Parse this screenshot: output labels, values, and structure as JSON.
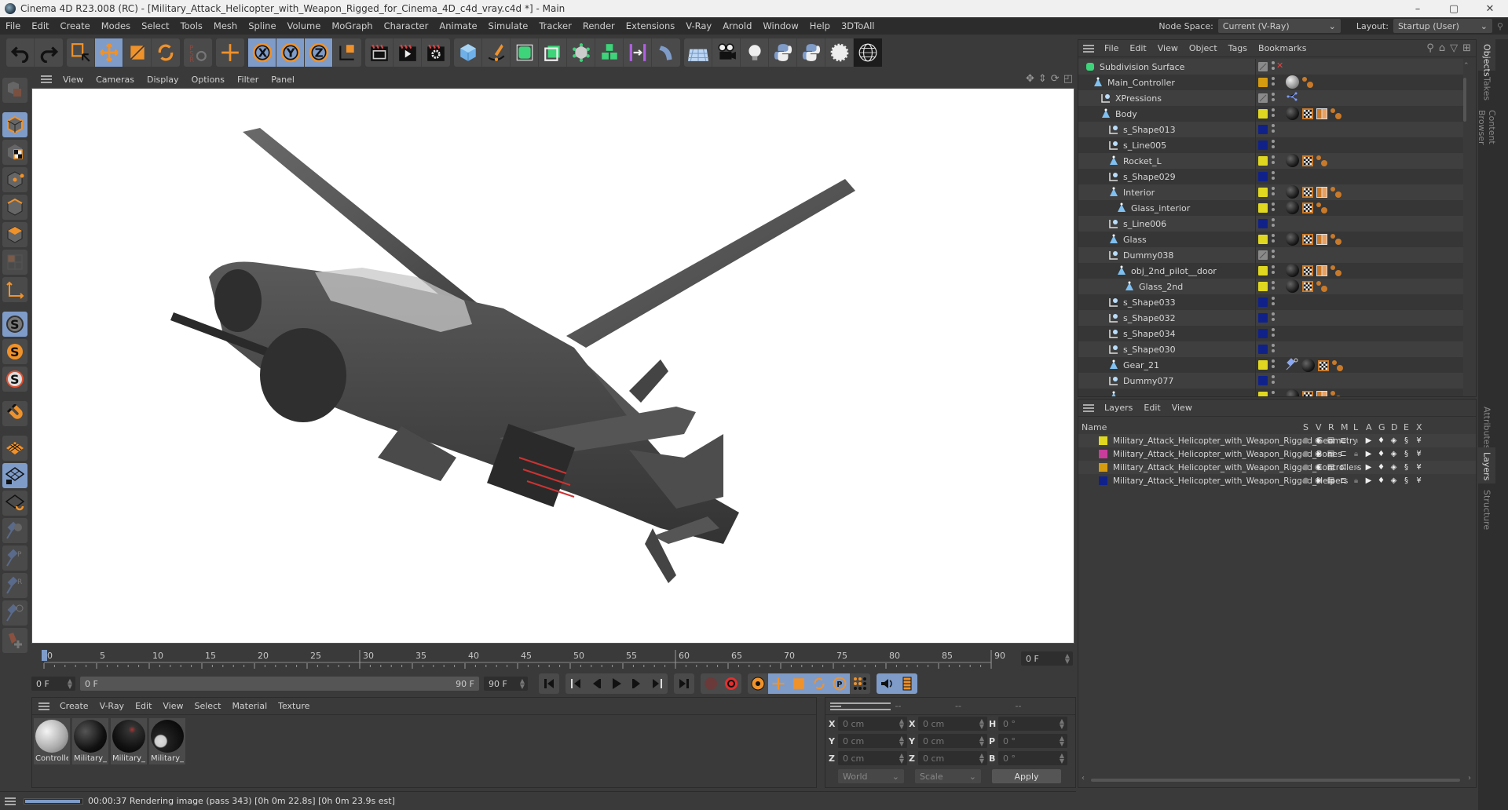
{
  "window": {
    "title": "Cinema 4D R23.008 (RC) - [Military_Attack_Helicopter_with_Weapon_Rigged_for_Cinema_4D_c4d_vray.c4d *] - Main",
    "controls": {
      "minimize": "–",
      "maximize": "▢",
      "close": "✕"
    }
  },
  "menubar": {
    "items": [
      "File",
      "Edit",
      "Create",
      "Modes",
      "Select",
      "Tools",
      "Mesh",
      "Spline",
      "Volume",
      "MoGraph",
      "Character",
      "Animate",
      "Simulate",
      "Tracker",
      "Render",
      "Extensions",
      "V-Ray",
      "Arnold",
      "Window",
      "Help",
      "3DToAll"
    ],
    "node_space_label": "Node Space:",
    "node_space_value": "Current (V-Ray)",
    "layout_label": "Layout:",
    "layout_value": "Startup (User)"
  },
  "toolbar": {
    "groups": [
      [
        "undo-icon",
        "redo-icon"
      ],
      [
        "live-selection-icon",
        "move-icon",
        "scale-icon",
        "rotate-icon"
      ],
      [
        "psr-icon"
      ],
      [
        "axis-move-icon"
      ],
      [
        "x-axis-lock-icon",
        "y-axis-lock-icon",
        "z-axis-lock-icon",
        "coordinate-system-icon"
      ],
      [
        "render-view-icon",
        "render-to-picture-viewer-icon",
        "render-settings-icon"
      ],
      [
        "cube-primitive-icon",
        "pen-spline-icon",
        "subdivision-surface-icon",
        "extrude-icon",
        "cloner-icon",
        "mograph-cubes-icon",
        "symmetry-icon",
        "deformer-icon"
      ],
      [
        "floor-icon",
        "camera-icon",
        "light-icon",
        "python-icon",
        "python-generator-icon",
        "sky-icon",
        "vray-dome-icon"
      ]
    ],
    "active": [
      "move-icon",
      "x-axis-lock-icon",
      "y-axis-lock-icon",
      "z-axis-lock-icon"
    ]
  },
  "lefttools": {
    "items": [
      "make-editable-icon",
      "model-mode-icon",
      "texture-mode-icon",
      "points-mode-icon",
      "edges-mode-icon",
      "polygons-mode-icon",
      "uv-mode-icon",
      "axis-mode-icon",
      "solo-icon",
      "solo-single-icon",
      "solo-hierarchy-icon",
      "snap-icon",
      "workplane-icon",
      "locked-workplane-icon",
      "workplane-rotate-icon",
      "pin-icon",
      "pin-p-icon",
      "pin-r-icon",
      "pin-target-icon",
      "joint-tool-icon"
    ]
  },
  "viewport": {
    "menu": [
      "View",
      "Cameras",
      "Display",
      "Options",
      "Filter",
      "Panel"
    ],
    "nav_icons": [
      "move-view-icon",
      "zoom-view-icon",
      "rotate-view-icon",
      "maximize-view-icon"
    ],
    "content": "Military attack helicopter render, gray, viewed from below"
  },
  "timeline": {
    "ticks": [
      0,
      5,
      10,
      15,
      20,
      25,
      30,
      35,
      40,
      45,
      50,
      55,
      60,
      65,
      70,
      75,
      80,
      85,
      90
    ],
    "range_max": 90,
    "current_frame": 0,
    "current_frame_field": "0 F"
  },
  "transport": {
    "start_field": "0 F",
    "range_start": "0 F",
    "range_end": "90 F",
    "end_field": "90 F",
    "buttons": [
      "go-to-start-icon",
      "prev-key-icon",
      "prev-frame-icon",
      "play-icon",
      "next-frame-icon",
      "next-key-icon",
      "go-to-end-icon",
      "record-disabled-icon",
      "autokey-icon",
      "keyframe-settings-icon",
      "key-position-icon",
      "key-scale-icon",
      "key-rotation-icon",
      "key-parameter-icon",
      "key-pla-icon",
      "sound-icon",
      "film-icon"
    ]
  },
  "material_manager": {
    "menu": [
      "Create",
      "V-Ray",
      "Edit",
      "View",
      "Select",
      "Material",
      "Texture"
    ],
    "materials": [
      {
        "label": "Controlle",
        "color": "white"
      },
      {
        "label": "Military_",
        "color": "black"
      },
      {
        "label": "Military_",
        "color": "black-red"
      },
      {
        "label": "Military_",
        "color": "black-white"
      }
    ]
  },
  "coordinates": {
    "headers": [
      "--",
      "--",
      "--"
    ],
    "rows": [
      {
        "a": "X",
        "pos": "0 cm",
        "b": "X",
        "size": "0 cm",
        "c": "H",
        "rot": "0 °"
      },
      {
        "a": "Y",
        "pos": "0 cm",
        "b": "Y",
        "size": "0 cm",
        "c": "P",
        "rot": "0 °"
      },
      {
        "a": "Z",
        "pos": "0 cm",
        "b": "Z",
        "size": "0 cm",
        "c": "B",
        "rot": "0 °"
      }
    ],
    "mode": "World",
    "scale_mode": "Scale",
    "apply": "Apply"
  },
  "status": {
    "progress": 0.95,
    "text": "00:00:37 Rendering image (pass 343) [0h  0m 22.8s] [0h  0m 23.9s est]"
  },
  "object_manager": {
    "menu": [
      "File",
      "Edit",
      "View",
      "Object",
      "Tags",
      "Bookmarks"
    ],
    "objects": [
      {
        "name": "Subdivision Surface",
        "indent": 0,
        "type": "subdiv",
        "color": "#7a7a7a",
        "tags": [],
        "disabled": true
      },
      {
        "name": "Main_Controller",
        "indent": 1,
        "type": "joint",
        "color": "#d49a10",
        "tags": [
          "mat-white",
          "ball"
        ]
      },
      {
        "name": "XPressions",
        "indent": 2,
        "type": "null",
        "color": "#7a7a7a",
        "tags": [
          "xpresso"
        ]
      },
      {
        "name": "Body",
        "indent": 2,
        "type": "joint",
        "color": "#e0d820",
        "tags": [
          "mat",
          "chk",
          "uv",
          "ball"
        ]
      },
      {
        "name": "s_Shape013",
        "indent": 3,
        "type": "null",
        "color": "#10228a",
        "tags": []
      },
      {
        "name": "s_Line005",
        "indent": 3,
        "type": "null",
        "color": "#10228a",
        "tags": []
      },
      {
        "name": "Rocket_L",
        "indent": 3,
        "type": "joint",
        "color": "#e0d820",
        "tags": [
          "mat",
          "chk",
          "ball"
        ]
      },
      {
        "name": "s_Shape029",
        "indent": 3,
        "type": "null",
        "color": "#10228a",
        "tags": []
      },
      {
        "name": "Interior",
        "indent": 3,
        "type": "joint",
        "color": "#e0d820",
        "tags": [
          "mat",
          "chk",
          "uv",
          "ball"
        ]
      },
      {
        "name": "Glass_interior",
        "indent": 4,
        "type": "joint",
        "color": "#e0d820",
        "tags": [
          "mat",
          "chk",
          "ball"
        ]
      },
      {
        "name": "s_Line006",
        "indent": 3,
        "type": "null",
        "color": "#10228a",
        "tags": []
      },
      {
        "name": "Glass",
        "indent": 3,
        "type": "joint",
        "color": "#e0d820",
        "tags": [
          "mat",
          "chk",
          "uv",
          "ball"
        ]
      },
      {
        "name": "Dummy038",
        "indent": 3,
        "type": "null",
        "color": "#7a7a7a",
        "tags": []
      },
      {
        "name": "obj_2nd_pilot__door",
        "indent": 4,
        "type": "joint",
        "color": "#e0d820",
        "tags": [
          "mat",
          "chk",
          "uv",
          "ball"
        ]
      },
      {
        "name": "Glass_2nd",
        "indent": 5,
        "type": "joint",
        "color": "#e0d820",
        "tags": [
          "mat",
          "chk",
          "ball"
        ]
      },
      {
        "name": "s_Shape033",
        "indent": 3,
        "type": "null",
        "color": "#10228a",
        "tags": []
      },
      {
        "name": "s_Shape032",
        "indent": 3,
        "type": "null",
        "color": "#10228a",
        "tags": []
      },
      {
        "name": "s_Shape034",
        "indent": 3,
        "type": "null",
        "color": "#10228a",
        "tags": []
      },
      {
        "name": "s_Shape030",
        "indent": 3,
        "type": "null",
        "color": "#10228a",
        "tags": []
      },
      {
        "name": "Gear_21",
        "indent": 3,
        "type": "joint",
        "color": "#e0d820",
        "tags": [
          "pin",
          "mat",
          "chk",
          "ball"
        ]
      },
      {
        "name": "Dummy077",
        "indent": 3,
        "type": "null",
        "color": "#10228a",
        "tags": []
      },
      {
        "name": "",
        "indent": 3,
        "type": "joint",
        "color": "#e0d820",
        "tags": [
          "mat",
          "chk",
          "uv",
          "ball"
        ]
      }
    ]
  },
  "layer_manager": {
    "menu": [
      "Layers",
      "Edit",
      "View"
    ],
    "columns": [
      "Name",
      "S",
      "V",
      "R",
      "M",
      "L",
      "A",
      "G",
      "D",
      "E",
      "X"
    ],
    "layers": [
      {
        "name": "Military_Attack_Helicopter_with_Weapon_Rigged_Geometry",
        "color": "#e0d820"
      },
      {
        "name": "Military_Attack_Helicopter_with_Weapon_Rigged_Bones",
        "color": "#c83c9c"
      },
      {
        "name": "Military_Attack_Helicopter_with_Weapon_Rigged_Controllers",
        "color": "#d49a10"
      },
      {
        "name": "Military_Attack_Helicopter_with_Weapon_Rigged_Helpers",
        "color": "#10228a"
      }
    ]
  },
  "side_tabs": {
    "top": [
      "Objects",
      "Takes",
      "Content Browser"
    ],
    "bottom": [
      "Attributes",
      "Layers",
      "Structure"
    ],
    "active_top": "Objects",
    "active_bottom": "Layers"
  },
  "colors": {
    "accent": "#7f9cc9",
    "orange": "#f0922a",
    "panel": "#3a3a3a"
  }
}
